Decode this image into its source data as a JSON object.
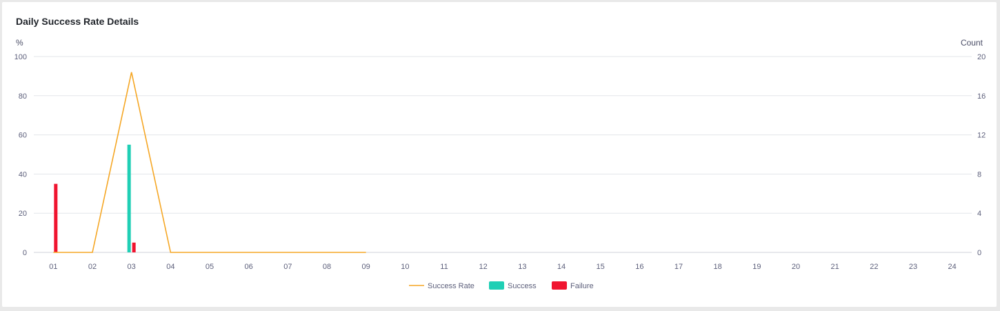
{
  "card": {
    "title": "Daily Success Rate Details"
  },
  "chart_data": {
    "type": "bar",
    "title": "Daily Success Rate Details",
    "categories": [
      "01",
      "02",
      "03",
      "04",
      "05",
      "06",
      "07",
      "08",
      "09",
      "10",
      "11",
      "12",
      "13",
      "14",
      "15",
      "16",
      "17",
      "18",
      "19",
      "20",
      "21",
      "22",
      "23",
      "24"
    ],
    "y_left": {
      "label": "%",
      "ylim": [
        0,
        100
      ],
      "ticks": [
        0,
        20,
        40,
        60,
        80,
        100
      ]
    },
    "y_right": {
      "label": "Count",
      "ylim": [
        0,
        20
      ],
      "ticks": [
        0,
        4,
        8,
        12,
        16,
        20
      ]
    },
    "series": [
      {
        "name": "Success Rate",
        "type": "line",
        "axis": "left",
        "color": "#f5a623",
        "values": [
          0,
          0,
          92,
          0,
          0,
          0,
          0,
          0,
          0
        ]
      },
      {
        "name": "Success",
        "type": "bar",
        "axis": "right",
        "color": "#1fcfb5",
        "values": [
          0,
          0,
          11,
          0,
          0,
          0,
          0,
          0,
          0
        ]
      },
      {
        "name": "Failure",
        "type": "bar",
        "axis": "right",
        "color": "#f0142f",
        "values": [
          7,
          0,
          1,
          0,
          0,
          0,
          0,
          0,
          0
        ]
      }
    ],
    "grid": true,
    "legend": "bottom-center"
  }
}
